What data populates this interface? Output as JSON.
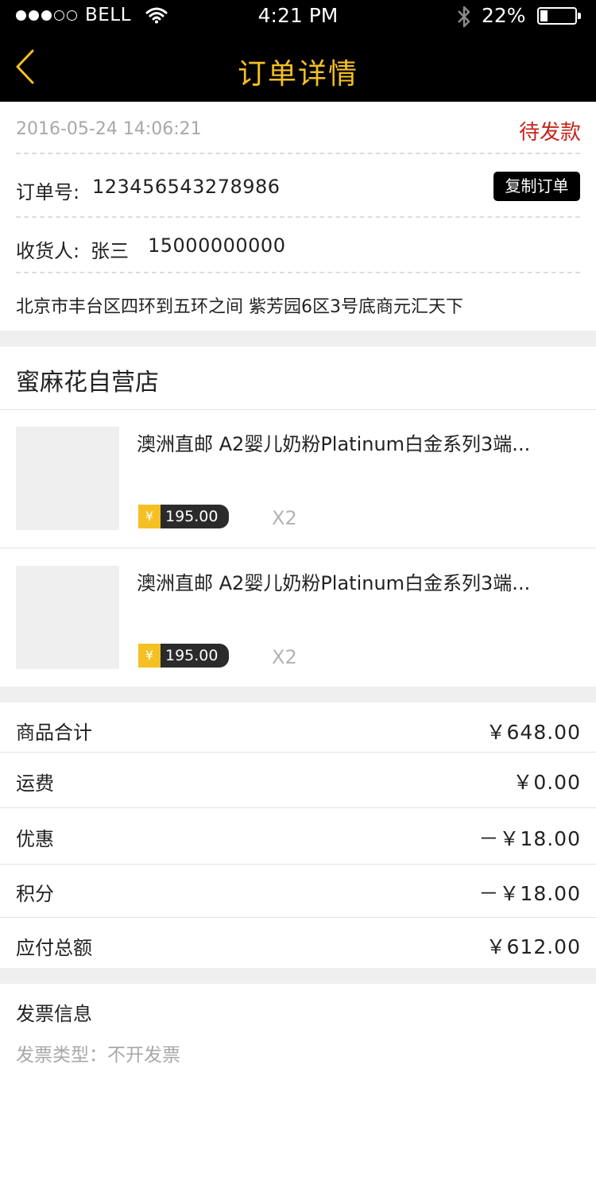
{
  "status_bar": {
    "carrier": "BELL",
    "time": "4:21 PM",
    "battery_percent": "22%",
    "battery_level": 0.22,
    "signal_dots_filled": 3,
    "signal_dots_total": 5,
    "icons": [
      "wifi-icon",
      "bluetooth-icon",
      "battery-icon"
    ]
  },
  "nav": {
    "title": "订单详情",
    "back_icon": "chevron-left-icon",
    "accent_color": "#f5c024"
  },
  "order": {
    "datetime": "2016-05-24 14:06:21",
    "status": "待发款",
    "status_color": "#c8231b",
    "number_label": "订单号:",
    "number": "123456543278986",
    "copy_button": "复制订单",
    "receiver_label": "收货人:",
    "receiver_name": "张三",
    "receiver_phone": "15000000000",
    "address": "北京市丰台区四环到五环之间 紫芳园6区3号底商元汇天下"
  },
  "store": {
    "name": "蜜麻花自营店",
    "products": [
      {
        "title": "澳洲直邮 A2婴儿奶粉Platinum白金系列3端...",
        "currency": "¥",
        "price": "195.00",
        "quantity": "X2"
      },
      {
        "title": "澳洲直邮 A2婴儿奶粉Platinum白金系列3端...",
        "currency": "¥",
        "price": "195.00",
        "quantity": "X2"
      }
    ]
  },
  "summary": {
    "rows": [
      {
        "label": "商品合计",
        "value": "￥648.00"
      },
      {
        "label": "运费",
        "value": "￥0.00"
      },
      {
        "label": "优惠",
        "value": "－￥18.00"
      },
      {
        "label": "积分",
        "value": "－￥18.00"
      },
      {
        "label": "应付总额",
        "value": "￥612.00"
      }
    ]
  },
  "invoice": {
    "title": "发票信息",
    "type_text": "发票类型：不开发票"
  }
}
